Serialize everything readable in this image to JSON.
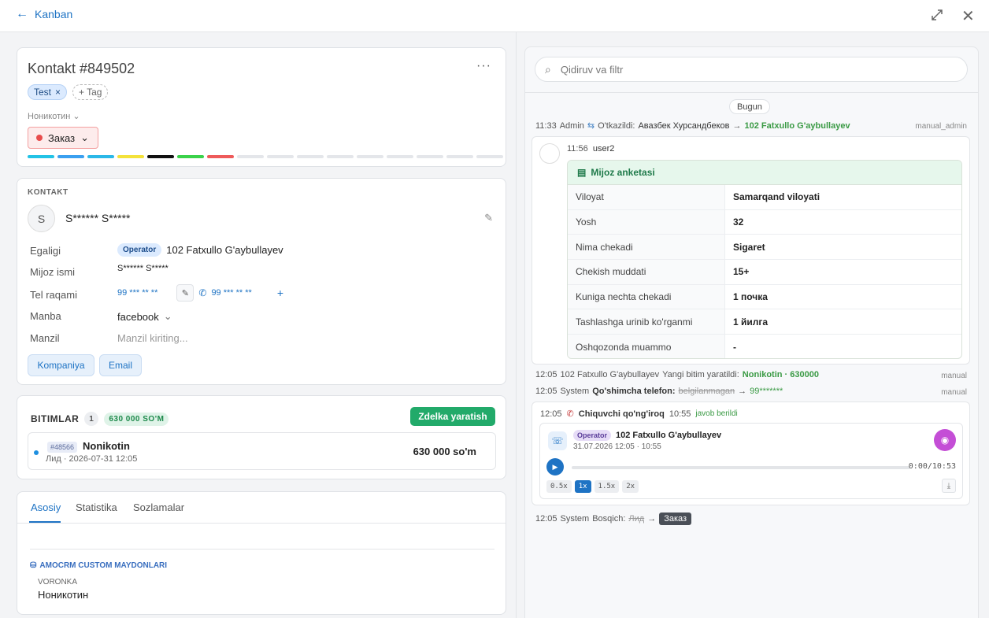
{
  "topbar": {
    "back_label": "Kanban"
  },
  "contact": {
    "title": "Kontakt #849502",
    "tags": [
      "Test"
    ],
    "add_tag_label": "+ Tag",
    "pipeline_label": "Ноникотин",
    "stage_label": "Заказ",
    "stage_colors": [
      "#22c3e6",
      "#3aa0f0",
      "#2bb8e8",
      "#f4e23a",
      "#111111",
      "#3ad24a",
      "#ee5a5a",
      "#e4e6ea",
      "#e4e6ea",
      "#e4e6ea",
      "#e4e6ea",
      "#e4e6ea",
      "#e4e6ea",
      "#e4e6ea",
      "#e4e6ea",
      "#e4e6ea"
    ]
  },
  "kontakt": {
    "section_label": "KONTAKT",
    "avatar_letter": "S",
    "name": "S****** S*****",
    "rows": {
      "egaligi_label": "Egaligi",
      "egaligi_badge": "Operator",
      "egaligi_value": "102 Fatxullo G'aybullayev",
      "mijoz_label": "Mijoz ismi",
      "mijoz_value": "S****** S*****",
      "tel_label": "Tel raqami",
      "tel_1": "99 *** ** **",
      "tel_2": "99 *** ** **",
      "manba_label": "Manba",
      "manba_value": "facebook",
      "manzil_label": "Manzil",
      "manzil_placeholder": "Manzil kiriting..."
    },
    "btn_kompaniya": "Kompaniya",
    "btn_email": "Email"
  },
  "bitimlar": {
    "label": "BITIMLAR",
    "count": "1",
    "sum": "630 000 SO'M",
    "create_label": "Zdelka yaratish",
    "deal": {
      "id": "#48566",
      "name": "Nonikotin",
      "sub": "Лид · 2026-07-31 12:05",
      "amount": "630 000 so'm"
    }
  },
  "tabs": {
    "items": [
      "Asosiy",
      "Statistika",
      "Sozlamalar"
    ],
    "amocrm_label": "AMOCRM CUSTOM MAYDONLARI",
    "voronka_label": "VORONKA",
    "voronka_value": "Ноникотин"
  },
  "feed": {
    "search_placeholder": "Qidiruv va filtr",
    "day_label": "Bugun",
    "e1": {
      "time": "11:33",
      "who": "Admin",
      "text": "O'tkazildi:",
      "from": "Авазбек Хурсандбеков",
      "arrow": "→",
      "to": "102 Fatxullo G'aybullayev",
      "tag": "manual_admin"
    },
    "msg": {
      "time": "11:56",
      "user": "user2",
      "anketa_title": "Mijoz anketasi",
      "rows": [
        {
          "k": "Viloyat",
          "v": "Samarqand viloyati"
        },
        {
          "k": "Yosh",
          "v": "32"
        },
        {
          "k": "Nima chekadi",
          "v": "Sigaret"
        },
        {
          "k": "Chekish muddati",
          "v": "15+"
        },
        {
          "k": "Kuniga nechta chekadi",
          "v": "1 почка"
        },
        {
          "k": "Tashlashga urinib ko'rganmi",
          "v": "1 йилга"
        },
        {
          "k": "Oshqozonda muammo",
          "v": "-"
        }
      ]
    },
    "e2": {
      "time": "12:05",
      "who": "102 Fatxullo G'aybullayev",
      "text": "Yangi bitim yaratildi:",
      "value": "Nonikotin · 630000",
      "tag": "manual"
    },
    "e3": {
      "time": "12:05",
      "who": "System",
      "text": "Qo'shimcha telefon:",
      "old": "belgilanmagan",
      "arrow": "→",
      "new": "99*******",
      "tag": "manual"
    },
    "call": {
      "time": "12:05",
      "type": "Chiquvchi qo'ng'iroq",
      "at": "10:55",
      "status": "javob berildi",
      "badge": "Operator",
      "name": "102 Fatxullo G'aybullayev",
      "date": "31.07.2026 12:05 · 10:55",
      "timer": "0:00/10:53",
      "speeds": [
        "0.5x",
        "1x",
        "1.5x",
        "2x"
      ]
    },
    "e4": {
      "time": "12:05",
      "who": "System",
      "text": "Bosqich:",
      "old": "Лид",
      "arrow": "→",
      "new": "Заказ"
    }
  }
}
